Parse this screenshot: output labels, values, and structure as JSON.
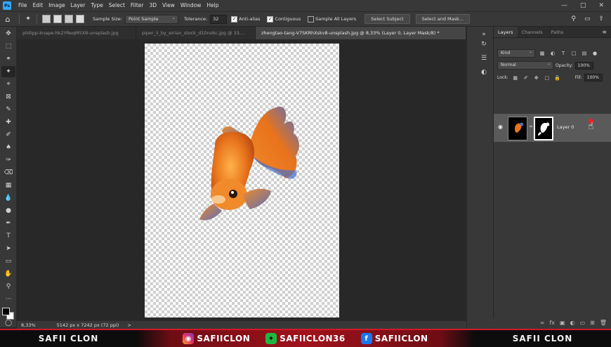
{
  "menubar": {
    "logo": "Ps",
    "items": [
      "File",
      "Edit",
      "Image",
      "Layer",
      "Type",
      "Select",
      "Filter",
      "3D",
      "View",
      "Window",
      "Help"
    ]
  },
  "options": {
    "sample_size_label": "Sample Size:",
    "sample_size_value": "Point Sample",
    "tolerance_label": "Tolerance:",
    "tolerance_value": "32",
    "anti_alias_label": "Anti-alias",
    "contiguous_label": "Contiguous",
    "sample_all_layers_label": "Sample All Layers",
    "select_subject_label": "Select Subject",
    "select_and_mask_label": "Select and Mask..."
  },
  "tabs": [
    {
      "label": "philipp-knape-hk2YReqM5X8-unsplash.jpg",
      "active": false
    },
    {
      "label": "piper_ii_by_eirian_stock_d10ns6c.jpg @ 33,...",
      "active": false
    },
    {
      "label": "zhengtao-tang-V7SKRhXskv8-unsplash.jpg @ 8,33% (Layer 0, Layer Mask/8) *",
      "active": true
    }
  ],
  "status": {
    "zoom": "8,33%",
    "doc_size": "5142 px x 7242 px (72 ppi)",
    "arrow": ">"
  },
  "layers_panel": {
    "tabs": [
      "Layers",
      "Channels",
      "Paths"
    ],
    "kind_label": "Kind",
    "blend_mode": "Normal",
    "opacity_label": "Opacity:",
    "opacity_value": "100%",
    "lock_label": "Lock:",
    "fill_label": "Fill:",
    "fill_value": "100%",
    "layer_name": "Layer 0"
  },
  "banner": {
    "left_name": "SAFII CLON",
    "instagram": "SAFIICLON",
    "gamejolt": "SAFIICLON36",
    "facebook": "SAFIICLON",
    "right_name": "SAFII CLON"
  },
  "colors": {
    "accent_blue": "#31a8ff",
    "banner_red": "#a0121c",
    "fish_orange": "#e8731c"
  }
}
